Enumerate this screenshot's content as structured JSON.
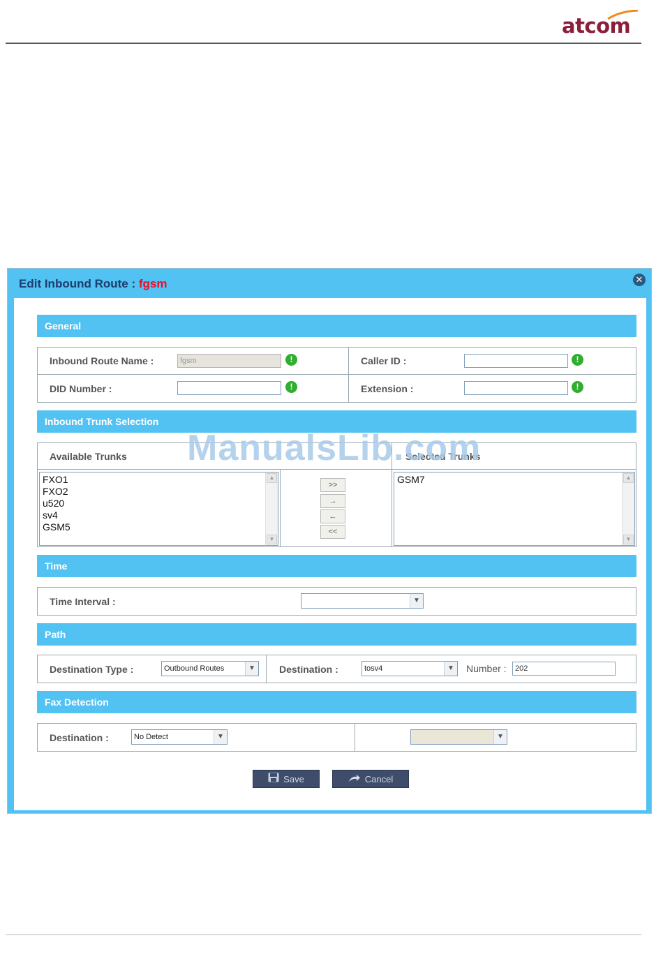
{
  "brand": {
    "logo_text": "atcom"
  },
  "dialog": {
    "title_prefix": "Edit Inbound Route : ",
    "title_name": "fgsm",
    "close_symbol": "✕"
  },
  "sections": {
    "general": "General",
    "trunks": "Inbound Trunk Selection",
    "time": "Time",
    "path": "Path",
    "fax": "Fax Detection"
  },
  "general": {
    "route_name_label": "Inbound Route Name :",
    "route_name_value": "fgsm",
    "caller_id_label": "Caller ID :",
    "caller_id_value": "",
    "did_label": "DID Number :",
    "did_value": "",
    "extension_label": "Extension :",
    "extension_value": ""
  },
  "trunks": {
    "available_label": "Available Trunks",
    "selected_label": "Selected Trunks",
    "available": [
      "FXO1",
      "FXO2",
      "u520",
      "sv4",
      "GSM5"
    ],
    "selected": [
      "GSM7"
    ],
    "move_all_right": ">>",
    "move_right": "→",
    "move_left": "←",
    "move_all_left": "<<"
  },
  "time": {
    "interval_label": "Time Interval :",
    "interval_value": ""
  },
  "path": {
    "dest_type_label": "Destination Type :",
    "dest_type_value": "Outbound Routes",
    "destination_label": "Destination :",
    "destination_value": "tosv4",
    "number_label": "Number :",
    "number_value": "202"
  },
  "fax": {
    "destination_label": "Destination :",
    "destination_value": "No Detect",
    "secondary_value": ""
  },
  "buttons": {
    "save": "Save",
    "cancel": "Cancel"
  },
  "icons": {
    "required": "!",
    "dropdown": "▼",
    "scroll_up": "▲",
    "scroll_down": "▼"
  },
  "watermark": "ManualsLib.com",
  "colors": {
    "header_blue": "#52c2f2",
    "title_text": "#1b3d6e",
    "title_name": "#e8102a",
    "ok_green": "#2fae2f",
    "button_dark": "#3f4d6b",
    "brand": "#8a1e3b"
  }
}
